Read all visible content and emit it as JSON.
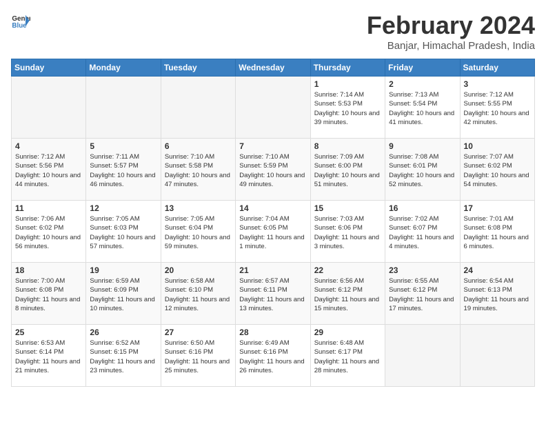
{
  "header": {
    "logo_general": "General",
    "logo_blue": "Blue",
    "title": "February 2024",
    "subtitle": "Banjar, Himachal Pradesh, India"
  },
  "weekdays": [
    "Sunday",
    "Monday",
    "Tuesday",
    "Wednesday",
    "Thursday",
    "Friday",
    "Saturday"
  ],
  "weeks": [
    [
      {
        "day": "",
        "sunrise": "",
        "sunset": "",
        "daylight": ""
      },
      {
        "day": "",
        "sunrise": "",
        "sunset": "",
        "daylight": ""
      },
      {
        "day": "",
        "sunrise": "",
        "sunset": "",
        "daylight": ""
      },
      {
        "day": "",
        "sunrise": "",
        "sunset": "",
        "daylight": ""
      },
      {
        "day": "1",
        "sunrise": "Sunrise: 7:14 AM",
        "sunset": "Sunset: 5:53 PM",
        "daylight": "Daylight: 10 hours and 39 minutes."
      },
      {
        "day": "2",
        "sunrise": "Sunrise: 7:13 AM",
        "sunset": "Sunset: 5:54 PM",
        "daylight": "Daylight: 10 hours and 41 minutes."
      },
      {
        "day": "3",
        "sunrise": "Sunrise: 7:12 AM",
        "sunset": "Sunset: 5:55 PM",
        "daylight": "Daylight: 10 hours and 42 minutes."
      }
    ],
    [
      {
        "day": "4",
        "sunrise": "Sunrise: 7:12 AM",
        "sunset": "Sunset: 5:56 PM",
        "daylight": "Daylight: 10 hours and 44 minutes."
      },
      {
        "day": "5",
        "sunrise": "Sunrise: 7:11 AM",
        "sunset": "Sunset: 5:57 PM",
        "daylight": "Daylight: 10 hours and 46 minutes."
      },
      {
        "day": "6",
        "sunrise": "Sunrise: 7:10 AM",
        "sunset": "Sunset: 5:58 PM",
        "daylight": "Daylight: 10 hours and 47 minutes."
      },
      {
        "day": "7",
        "sunrise": "Sunrise: 7:10 AM",
        "sunset": "Sunset: 5:59 PM",
        "daylight": "Daylight: 10 hours and 49 minutes."
      },
      {
        "day": "8",
        "sunrise": "Sunrise: 7:09 AM",
        "sunset": "Sunset: 6:00 PM",
        "daylight": "Daylight: 10 hours and 51 minutes."
      },
      {
        "day": "9",
        "sunrise": "Sunrise: 7:08 AM",
        "sunset": "Sunset: 6:01 PM",
        "daylight": "Daylight: 10 hours and 52 minutes."
      },
      {
        "day": "10",
        "sunrise": "Sunrise: 7:07 AM",
        "sunset": "Sunset: 6:02 PM",
        "daylight": "Daylight: 10 hours and 54 minutes."
      }
    ],
    [
      {
        "day": "11",
        "sunrise": "Sunrise: 7:06 AM",
        "sunset": "Sunset: 6:02 PM",
        "daylight": "Daylight: 10 hours and 56 minutes."
      },
      {
        "day": "12",
        "sunrise": "Sunrise: 7:05 AM",
        "sunset": "Sunset: 6:03 PM",
        "daylight": "Daylight: 10 hours and 57 minutes."
      },
      {
        "day": "13",
        "sunrise": "Sunrise: 7:05 AM",
        "sunset": "Sunset: 6:04 PM",
        "daylight": "Daylight: 10 hours and 59 minutes."
      },
      {
        "day": "14",
        "sunrise": "Sunrise: 7:04 AM",
        "sunset": "Sunset: 6:05 PM",
        "daylight": "Daylight: 11 hours and 1 minute."
      },
      {
        "day": "15",
        "sunrise": "Sunrise: 7:03 AM",
        "sunset": "Sunset: 6:06 PM",
        "daylight": "Daylight: 11 hours and 3 minutes."
      },
      {
        "day": "16",
        "sunrise": "Sunrise: 7:02 AM",
        "sunset": "Sunset: 6:07 PM",
        "daylight": "Daylight: 11 hours and 4 minutes."
      },
      {
        "day": "17",
        "sunrise": "Sunrise: 7:01 AM",
        "sunset": "Sunset: 6:08 PM",
        "daylight": "Daylight: 11 hours and 6 minutes."
      }
    ],
    [
      {
        "day": "18",
        "sunrise": "Sunrise: 7:00 AM",
        "sunset": "Sunset: 6:08 PM",
        "daylight": "Daylight: 11 hours and 8 minutes."
      },
      {
        "day": "19",
        "sunrise": "Sunrise: 6:59 AM",
        "sunset": "Sunset: 6:09 PM",
        "daylight": "Daylight: 11 hours and 10 minutes."
      },
      {
        "day": "20",
        "sunrise": "Sunrise: 6:58 AM",
        "sunset": "Sunset: 6:10 PM",
        "daylight": "Daylight: 11 hours and 12 minutes."
      },
      {
        "day": "21",
        "sunrise": "Sunrise: 6:57 AM",
        "sunset": "Sunset: 6:11 PM",
        "daylight": "Daylight: 11 hours and 13 minutes."
      },
      {
        "day": "22",
        "sunrise": "Sunrise: 6:56 AM",
        "sunset": "Sunset: 6:12 PM",
        "daylight": "Daylight: 11 hours and 15 minutes."
      },
      {
        "day": "23",
        "sunrise": "Sunrise: 6:55 AM",
        "sunset": "Sunset: 6:12 PM",
        "daylight": "Daylight: 11 hours and 17 minutes."
      },
      {
        "day": "24",
        "sunrise": "Sunrise: 6:54 AM",
        "sunset": "Sunset: 6:13 PM",
        "daylight": "Daylight: 11 hours and 19 minutes."
      }
    ],
    [
      {
        "day": "25",
        "sunrise": "Sunrise: 6:53 AM",
        "sunset": "Sunset: 6:14 PM",
        "daylight": "Daylight: 11 hours and 21 minutes."
      },
      {
        "day": "26",
        "sunrise": "Sunrise: 6:52 AM",
        "sunset": "Sunset: 6:15 PM",
        "daylight": "Daylight: 11 hours and 23 minutes."
      },
      {
        "day": "27",
        "sunrise": "Sunrise: 6:50 AM",
        "sunset": "Sunset: 6:16 PM",
        "daylight": "Daylight: 11 hours and 25 minutes."
      },
      {
        "day": "28",
        "sunrise": "Sunrise: 6:49 AM",
        "sunset": "Sunset: 6:16 PM",
        "daylight": "Daylight: 11 hours and 26 minutes."
      },
      {
        "day": "29",
        "sunrise": "Sunrise: 6:48 AM",
        "sunset": "Sunset: 6:17 PM",
        "daylight": "Daylight: 11 hours and 28 minutes."
      },
      {
        "day": "",
        "sunrise": "",
        "sunset": "",
        "daylight": ""
      },
      {
        "day": "",
        "sunrise": "",
        "sunset": "",
        "daylight": ""
      }
    ]
  ]
}
